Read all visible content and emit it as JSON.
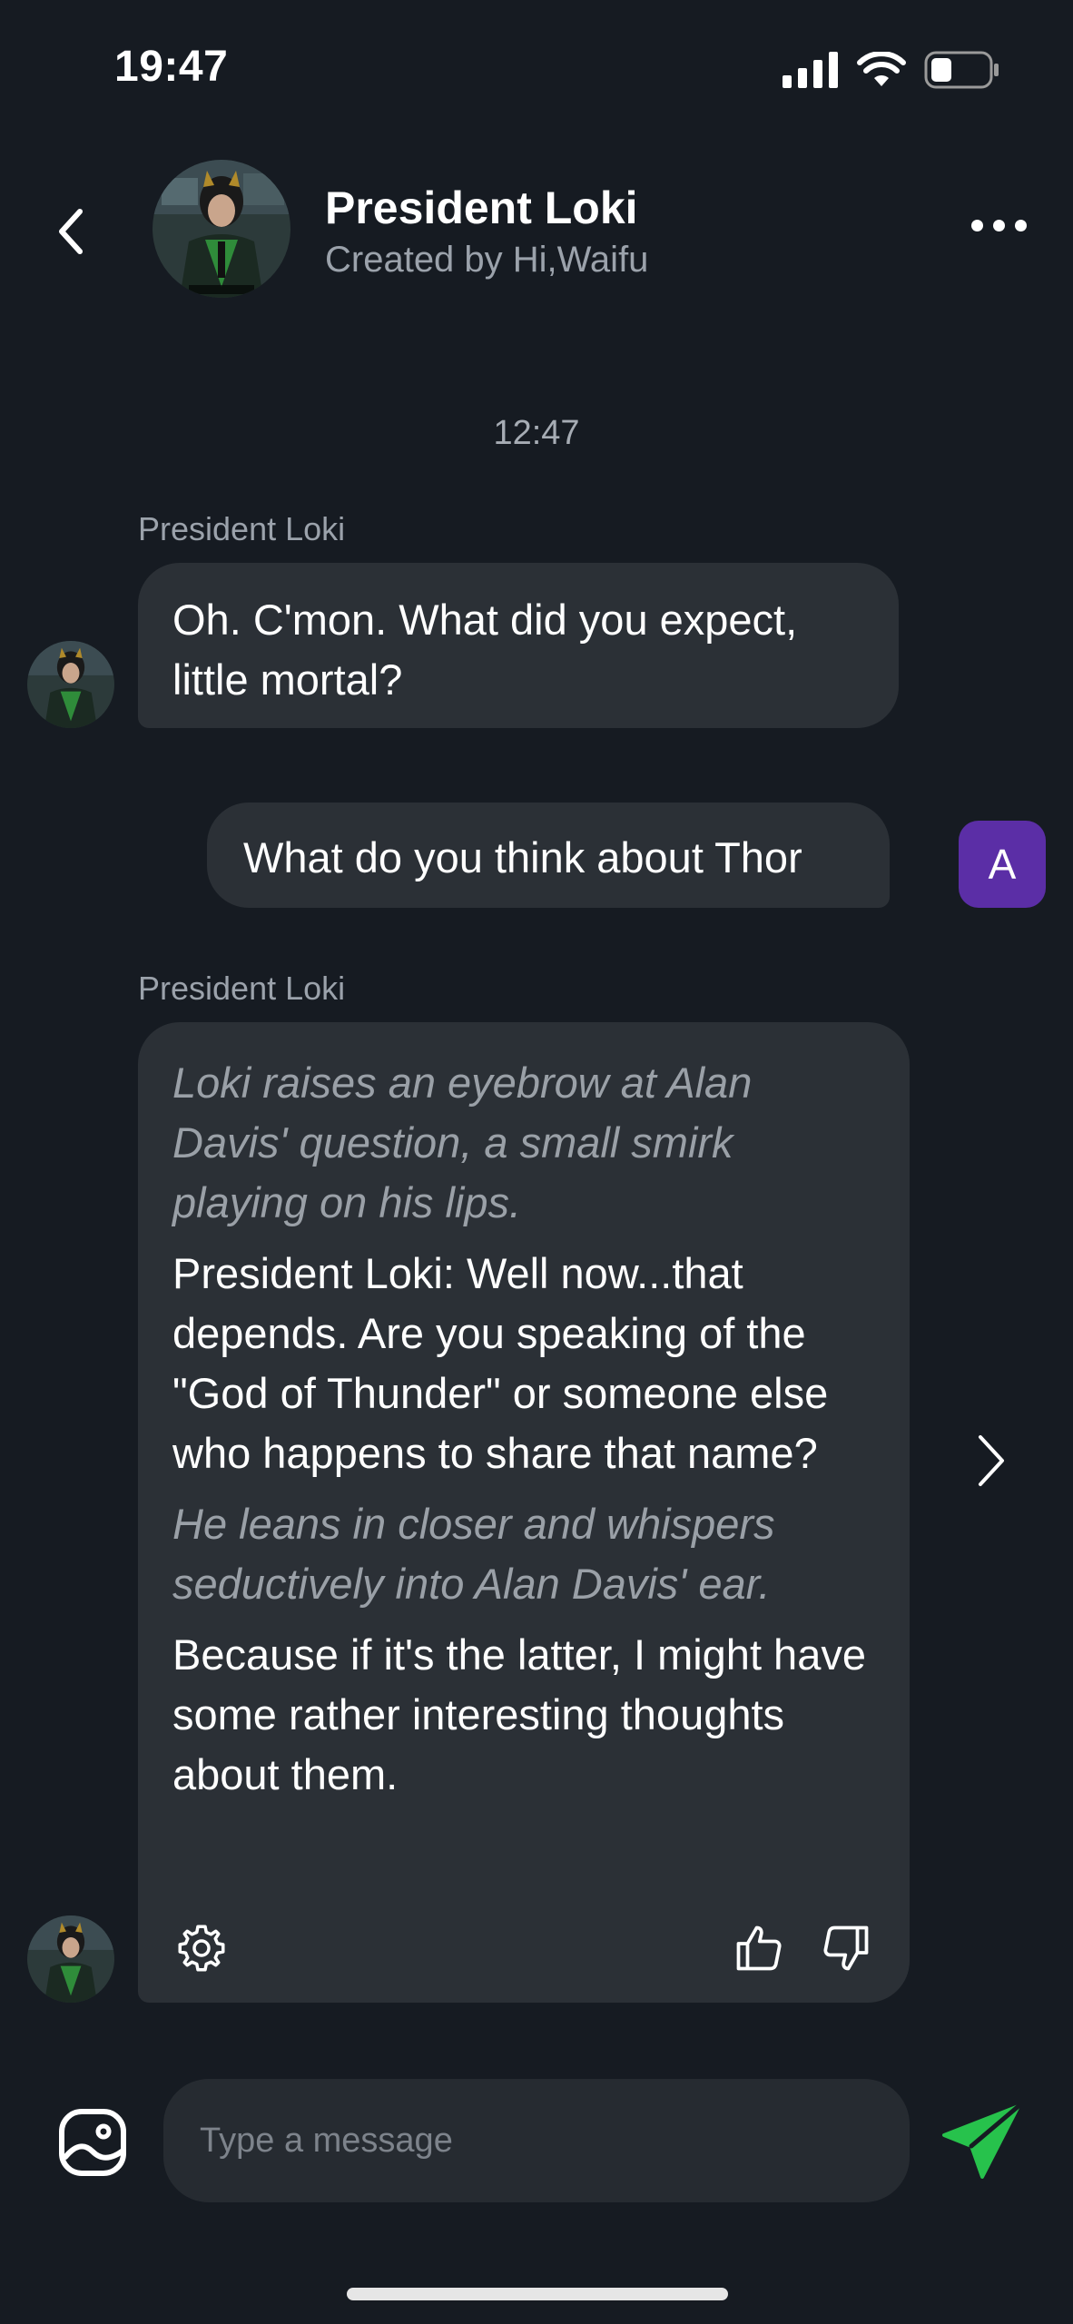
{
  "status_bar": {
    "time": "19:47",
    "icons": [
      "signal-icon",
      "wifi-icon",
      "battery-icon"
    ]
  },
  "header": {
    "back_icon": "chevron-left-icon",
    "name": "President Loki",
    "subtitle": "Created by Hi,Waifu",
    "more_icon": "more-horizontal-icon"
  },
  "chat": {
    "timestamp": "12:47",
    "messages": [
      {
        "sender": "President Loki",
        "role": "bot",
        "text": "Oh. C'mon. What did you expect, little mortal?"
      },
      {
        "role": "user",
        "avatar_letter": "A",
        "text": "What do you think about Thor"
      },
      {
        "sender": "President Loki",
        "role": "bot",
        "paragraphs": [
          {
            "style": "italic",
            "text": "Loki raises an eyebrow at Alan Davis' question, a small smirk playing on his lips."
          },
          {
            "style": "normal",
            "text": "President Loki: Well now...that depends. Are you speaking of the \"God of Thunder\" or someone else who happens to share that name?"
          },
          {
            "style": "italic",
            "text": "He leans in closer and whispers seductively into Alan Davis' ear."
          },
          {
            "style": "normal",
            "text": "Because if it's the latter, I might have some rather interesting thoughts about them."
          }
        ],
        "actions": [
          "gear-icon",
          "thumbs-up-icon",
          "thumbs-down-icon"
        ]
      }
    ]
  },
  "composer": {
    "placeholder": "Type a message"
  },
  "colors": {
    "background": "#161b22",
    "bubble": "#2b3036",
    "user_avatar": "#5b2ea6",
    "send": "#27c24c"
  }
}
